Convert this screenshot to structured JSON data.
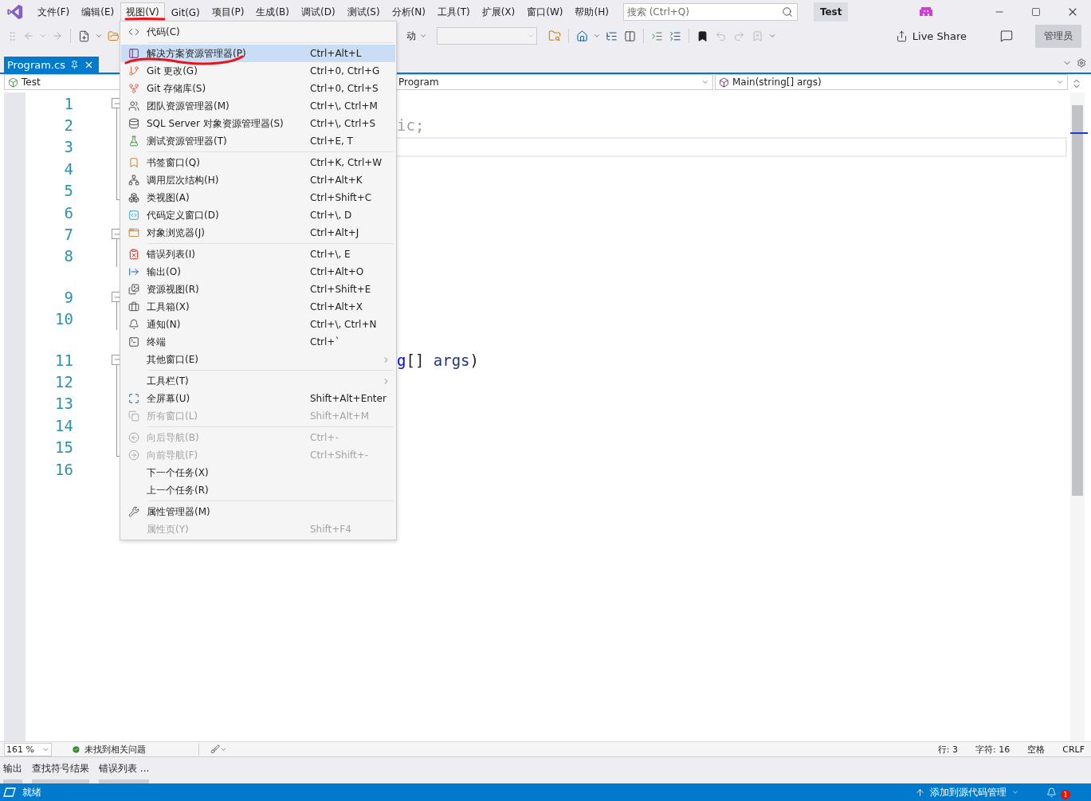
{
  "menu_bar": {
    "items": [
      {
        "label": "文件(F)",
        "selected": false
      },
      {
        "label": "编辑(E)",
        "selected": false
      },
      {
        "label": "视图(V)",
        "selected": true
      },
      {
        "label": "Git(G)",
        "selected": false
      },
      {
        "label": "项目(P)",
        "selected": false
      },
      {
        "label": "生成(B)",
        "selected": false
      },
      {
        "label": "调试(D)",
        "selected": false
      },
      {
        "label": "测试(S)",
        "selected": false
      },
      {
        "label": "分析(N)",
        "selected": false
      },
      {
        "label": "工具(T)",
        "selected": false
      },
      {
        "label": "扩展(X)",
        "selected": false
      },
      {
        "label": "窗口(W)",
        "selected": false
      },
      {
        "label": "帮助(H)",
        "selected": false
      }
    ],
    "search": {
      "placeholder": "搜索 (Ctrl+Q)"
    },
    "solution_name": "Test"
  },
  "toolbar": {
    "start_label": "动",
    "live_share": "Live Share",
    "role_badge": "管理员"
  },
  "document_tabs": [
    {
      "label": "Program.cs",
      "selected": true
    }
  ],
  "navigation_bar": {
    "project": "Test",
    "type": "Program",
    "member": "Main(string[] args)"
  },
  "editor": {
    "lines": [
      {
        "number": "1",
        "fold_toggle": true,
        "fold_guide": false,
        "fold_end": false,
        "codelens_above": false,
        "current": false
      },
      {
        "number": "2",
        "fold_toggle": false,
        "fold_guide": true,
        "fold_end": false,
        "codelens_above": false,
        "current": false,
        "code": [
          {
            "text": "ic;",
            "kind": "dim"
          }
        ]
      },
      {
        "number": "3",
        "fold_toggle": false,
        "fold_guide": true,
        "fold_end": false,
        "codelens_above": false,
        "current": true
      },
      {
        "number": "4",
        "fold_toggle": false,
        "fold_guide": true,
        "fold_end": false,
        "codelens_above": false,
        "current": false
      },
      {
        "number": "5",
        "fold_toggle": false,
        "fold_guide": true,
        "fold_end": true,
        "codelens_above": false,
        "current": false
      },
      {
        "number": "6",
        "fold_toggle": false,
        "fold_guide": false,
        "fold_end": false,
        "codelens_above": false,
        "current": false
      },
      {
        "number": "7",
        "fold_toggle": true,
        "fold_guide": false,
        "fold_end": false,
        "codelens_above": false,
        "current": false
      },
      {
        "number": "8",
        "fold_toggle": false,
        "fold_guide": true,
        "fold_end": false,
        "codelens_above": false,
        "current": false
      },
      {
        "number": "9",
        "fold_toggle": true,
        "fold_guide": false,
        "fold_end": false,
        "codelens_above": true,
        "current": false
      },
      {
        "number": "10",
        "fold_toggle": false,
        "fold_guide": true,
        "fold_end": false,
        "codelens_above": false,
        "current": false
      },
      {
        "number": "11",
        "fold_toggle": true,
        "fold_guide": false,
        "fold_end": false,
        "codelens_above": true,
        "current": false,
        "code": [
          {
            "text": "g",
            "kind": "keyword"
          },
          {
            "text": "[] ",
            "kind": "plain"
          },
          {
            "text": "args",
            "kind": "parameter"
          },
          {
            "text": ")",
            "kind": "plain"
          }
        ]
      },
      {
        "number": "12",
        "fold_toggle": false,
        "fold_guide": true,
        "fold_end": false,
        "codelens_above": false,
        "current": false
      },
      {
        "number": "13",
        "fold_toggle": false,
        "fold_guide": true,
        "fold_end": false,
        "codelens_above": false,
        "current": false
      },
      {
        "number": "14",
        "fold_toggle": false,
        "fold_guide": true,
        "fold_end": false,
        "codelens_above": false,
        "current": false
      },
      {
        "number": "15",
        "fold_toggle": false,
        "fold_guide": true,
        "fold_end": true,
        "codelens_above": false,
        "current": false
      },
      {
        "number": "16",
        "fold_toggle": false,
        "fold_guide": false,
        "fold_end": false,
        "codelens_above": false,
        "current": false
      }
    ]
  },
  "editor_status": {
    "zoom": "161 %",
    "issues": "未找到相关问题",
    "position": [
      "行: 3",
      "字符: 16",
      "空格",
      "CRLF"
    ]
  },
  "tool_tabs": [
    "输出",
    "查找符号结果",
    "错误列表 ..."
  ],
  "status_bar": {
    "state": "就绪",
    "source_control": "添加到源代码管理",
    "notifications": "1"
  },
  "view_menu": {
    "items": [
      {
        "kind": "item",
        "label": "代码(C)",
        "selected": false,
        "disabled": false
      },
      {
        "kind": "separator"
      },
      {
        "kind": "item",
        "label": "解决方案资源管理器(P)",
        "shortcut": "Ctrl+Alt+L",
        "selected": true,
        "disabled": false
      },
      {
        "kind": "item",
        "label": "Git 更改(G)",
        "shortcut": "Ctrl+0, Ctrl+G",
        "selected": false,
        "disabled": false
      },
      {
        "kind": "item",
        "label": "Git 存储库(S)",
        "shortcut": "Ctrl+0, Ctrl+S",
        "selected": false,
        "disabled": false
      },
      {
        "kind": "item",
        "label": "团队资源管理器(M)",
        "shortcut": "Ctrl+\\, Ctrl+M",
        "selected": false,
        "disabled": false
      },
      {
        "kind": "item",
        "label": "SQL Server 对象资源管理器(S)",
        "shortcut": "Ctrl+\\, Ctrl+S",
        "selected": false,
        "disabled": false
      },
      {
        "kind": "item",
        "label": "测试资源管理器(T)",
        "shortcut": "Ctrl+E, T",
        "selected": false,
        "disabled": false
      },
      {
        "kind": "separator"
      },
      {
        "kind": "item",
        "label": "书签窗口(Q)",
        "shortcut": "Ctrl+K, Ctrl+W",
        "selected": false,
        "disabled": false
      },
      {
        "kind": "item",
        "label": "调用层次结构(H)",
        "shortcut": "Ctrl+Alt+K",
        "selected": false,
        "disabled": false
      },
      {
        "kind": "item",
        "label": "类视图(A)",
        "shortcut": "Ctrl+Shift+C",
        "selected": false,
        "disabled": false
      },
      {
        "kind": "item",
        "label": "代码定义窗口(D)",
        "shortcut": "Ctrl+\\, D",
        "selected": false,
        "disabled": false
      },
      {
        "kind": "item",
        "label": "对象浏览器(J)",
        "shortcut": "Ctrl+Alt+J",
        "selected": false,
        "disabled": false
      },
      {
        "kind": "separator"
      },
      {
        "kind": "item",
        "label": "错误列表(I)",
        "shortcut": "Ctrl+\\, E",
        "selected": false,
        "disabled": false
      },
      {
        "kind": "item",
        "label": "输出(O)",
        "shortcut": "Ctrl+Alt+O",
        "selected": false,
        "disabled": false
      },
      {
        "kind": "item",
        "label": "资源视图(R)",
        "shortcut": "Ctrl+Shift+E",
        "selected": false,
        "disabled": false
      },
      {
        "kind": "item",
        "label": "工具箱(X)",
        "shortcut": "Ctrl+Alt+X",
        "selected": false,
        "disabled": false
      },
      {
        "kind": "item",
        "label": "通知(N)",
        "shortcut": "Ctrl+\\, Ctrl+N",
        "selected": false,
        "disabled": false
      },
      {
        "kind": "item",
        "label": "终端",
        "shortcut": "Ctrl+`",
        "selected": false,
        "disabled": false
      },
      {
        "kind": "submenu",
        "label": "其他窗口(E)",
        "selected": false,
        "disabled": false
      },
      {
        "kind": "separator"
      },
      {
        "kind": "submenu",
        "label": "工具栏(T)",
        "selected": false,
        "disabled": false
      },
      {
        "kind": "item",
        "label": "全屏幕(U)",
        "shortcut": "Shift+Alt+Enter",
        "selected": false,
        "disabled": false
      },
      {
        "kind": "item",
        "label": "所有窗口(L)",
        "shortcut": "Shift+Alt+M",
        "selected": false,
        "disabled": true
      },
      {
        "kind": "separator"
      },
      {
        "kind": "item",
        "label": "向后导航(B)",
        "shortcut": "Ctrl+-",
        "selected": false,
        "disabled": true
      },
      {
        "kind": "item",
        "label": "向前导航(F)",
        "shortcut": "Ctrl+Shift+-",
        "selected": false,
        "disabled": true
      },
      {
        "kind": "item",
        "label": "下一个任务(X)",
        "selected": false,
        "disabled": false
      },
      {
        "kind": "item",
        "label": "上一个任务(R)",
        "selected": false,
        "disabled": false
      },
      {
        "kind": "separator"
      },
      {
        "kind": "item",
        "label": "属性管理器(M)",
        "selected": false,
        "disabled": false
      },
      {
        "kind": "item",
        "label": "属性页(Y)",
        "shortcut": "Shift+F4",
        "selected": false,
        "disabled": true
      }
    ]
  }
}
